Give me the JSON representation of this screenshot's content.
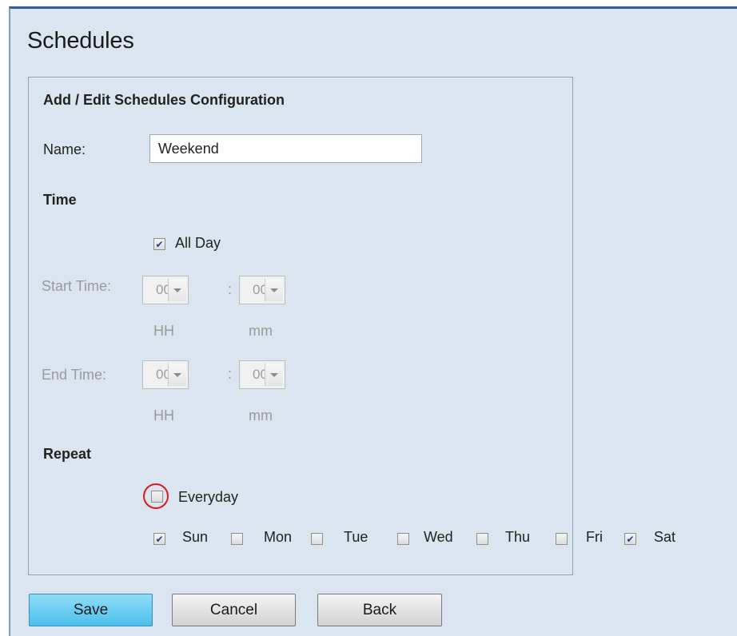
{
  "page": {
    "title": "Schedules"
  },
  "form": {
    "heading": "Add / Edit Schedules Configuration",
    "name_label": "Name:",
    "name_value": "Weekend",
    "time_heading": "Time",
    "all_day_label": "All Day",
    "all_day_checked": true,
    "start_label": "Start Time:",
    "end_label": "End Time:",
    "start_hour": "00",
    "start_minute": "00",
    "end_hour": "00",
    "end_minute": "00",
    "colon": ":",
    "hh_label": "HH",
    "mm_label": "mm",
    "repeat_heading": "Repeat",
    "everyday_label": "Everyday",
    "everyday_checked": false,
    "days": [
      {
        "label": "Sun",
        "checked": true
      },
      {
        "label": "Mon",
        "checked": false
      },
      {
        "label": "Tue",
        "checked": false
      },
      {
        "label": "Wed",
        "checked": false
      },
      {
        "label": "Thu",
        "checked": false
      },
      {
        "label": "Fri",
        "checked": false
      },
      {
        "label": "Sat",
        "checked": true
      }
    ]
  },
  "buttons": {
    "save": "Save",
    "cancel": "Cancel",
    "back": "Back"
  },
  "colors": {
    "panel_bg": "#dbe5ef",
    "highlight_ring": "#e01818",
    "save_button": "#4cc0ec"
  }
}
